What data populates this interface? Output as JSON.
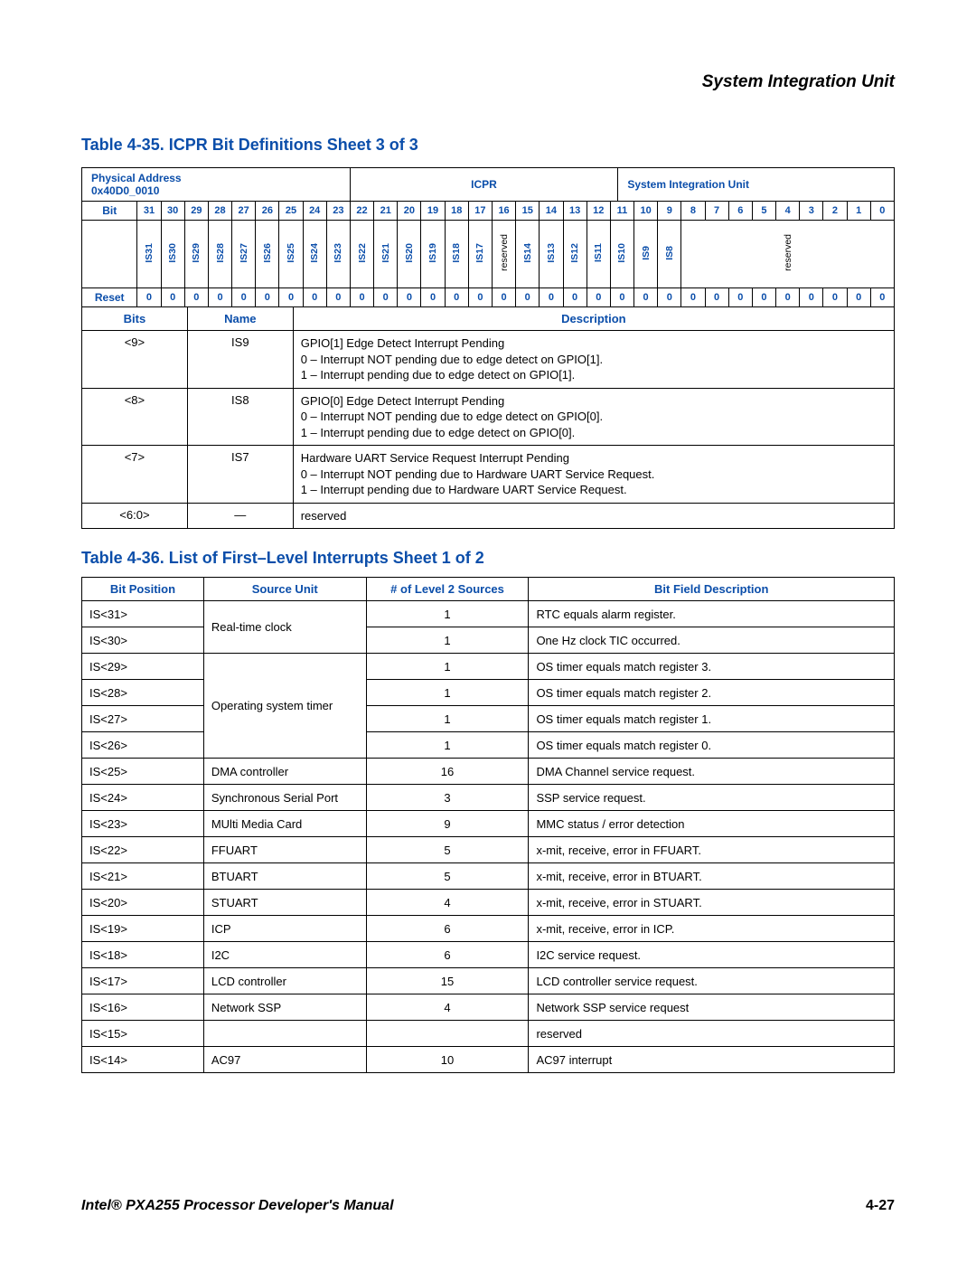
{
  "header": {
    "section": "System Integration Unit"
  },
  "table435": {
    "title": "Table 4-35. ICPR Bit Definitions Sheet 3 of 3",
    "meta": {
      "physical_label": "Physical Address",
      "physical_value": "0x40D0_0010",
      "register": "ICPR",
      "unit": "System Integration Unit"
    },
    "bit_row_label": "Bit",
    "reset_row_label": "Reset",
    "bit_numbers": [
      "31",
      "30",
      "29",
      "28",
      "27",
      "26",
      "25",
      "24",
      "23",
      "22",
      "21",
      "20",
      "19",
      "18",
      "17",
      "16",
      "15",
      "14",
      "13",
      "12",
      "11",
      "10",
      "9",
      "8",
      "7",
      "6",
      "5",
      "4",
      "3",
      "2",
      "1",
      "0"
    ],
    "bit_names": [
      "IS31",
      "IS30",
      "IS29",
      "IS28",
      "IS27",
      "IS26",
      "IS25",
      "IS24",
      "IS23",
      "IS22",
      "IS21",
      "IS20",
      "IS19",
      "IS18",
      "IS17",
      "reserved",
      "IS14",
      "IS13",
      "IS12",
      "IS11",
      "IS10",
      "IS9",
      "IS8",
      "",
      "",
      "",
      "",
      "",
      "",
      "",
      "",
      "reserved"
    ],
    "bit_reserved_flags": [
      false,
      false,
      false,
      false,
      false,
      false,
      false,
      false,
      false,
      false,
      false,
      false,
      false,
      false,
      false,
      true,
      false,
      false,
      false,
      false,
      false,
      false,
      false,
      false,
      false,
      false,
      false,
      false,
      false,
      false,
      false,
      true
    ],
    "reset_values": [
      "0",
      "0",
      "0",
      "0",
      "0",
      "0",
      "0",
      "0",
      "0",
      "0",
      "0",
      "0",
      "0",
      "0",
      "0",
      "0",
      "0",
      "0",
      "0",
      "0",
      "0",
      "0",
      "0",
      "0",
      "0",
      "0",
      "0",
      "0",
      "0",
      "0",
      "0",
      "0"
    ],
    "defs": {
      "headers": {
        "bits": "Bits",
        "name": "Name",
        "desc": "Description"
      },
      "rows": [
        {
          "bits": "<9>",
          "name": "IS9",
          "desc": [
            "GPIO[1] Edge Detect Interrupt Pending",
            "0 – Interrupt NOT pending due to edge detect on GPIO[1].",
            "1 – Interrupt pending due to edge detect on GPIO[1]."
          ]
        },
        {
          "bits": "<8>",
          "name": "IS8",
          "desc": [
            "GPIO[0] Edge Detect Interrupt Pending",
            "0 – Interrupt NOT pending due to edge detect on GPIO[0].",
            "1 – Interrupt pending due to edge detect on GPIO[0]."
          ]
        },
        {
          "bits": "<7>",
          "name": "IS7",
          "desc": [
            "Hardware UART Service Request Interrupt Pending",
            "0 – Interrupt NOT pending due to Hardware UART Service Request.",
            "1 – Interrupt pending due to Hardware UART Service Request."
          ]
        },
        {
          "bits": "<6:0>",
          "name": "—",
          "desc": [
            "reserved"
          ]
        }
      ]
    }
  },
  "table436": {
    "title": "Table 4-36. List of First–Level Interrupts Sheet 1 of 2",
    "headers": {
      "bitpos": "Bit Position",
      "source": "Source Unit",
      "level2": "# of Level 2 Sources",
      "desc": "Bit Field Description"
    },
    "rows": [
      {
        "bitpos": "IS<31>",
        "source": "Real-time clock",
        "rowspan": 2,
        "level2": "1",
        "desc": "RTC equals alarm register."
      },
      {
        "bitpos": "IS<30>",
        "level2": "1",
        "desc": "One Hz clock TIC occurred."
      },
      {
        "bitpos": "IS<29>",
        "source": "Operating system timer",
        "rowspan": 4,
        "level2": "1",
        "desc": "OS timer equals match register 3."
      },
      {
        "bitpos": "IS<28>",
        "level2": "1",
        "desc": "OS timer equals match register 2."
      },
      {
        "bitpos": "IS<27>",
        "level2": "1",
        "desc": "OS timer equals match register 1."
      },
      {
        "bitpos": "IS<26>",
        "level2": "1",
        "desc": "OS timer equals match register 0."
      },
      {
        "bitpos": "IS<25>",
        "source": "DMA controller",
        "rowspan": 1,
        "level2": "16",
        "desc": "DMA Channel service request."
      },
      {
        "bitpos": "IS<24>",
        "source": "Synchronous Serial Port",
        "rowspan": 1,
        "level2": "3",
        "desc": "SSP service request."
      },
      {
        "bitpos": "IS<23>",
        "source": "MUlti Media Card",
        "rowspan": 1,
        "level2": "9",
        "desc": "MMC status / error detection"
      },
      {
        "bitpos": "IS<22>",
        "source": "FFUART",
        "rowspan": 1,
        "level2": "5",
        "desc": "x-mit, receive, error in FFUART."
      },
      {
        "bitpos": "IS<21>",
        "source": "BTUART",
        "rowspan": 1,
        "level2": "5",
        "desc": "x-mit, receive, error in BTUART."
      },
      {
        "bitpos": "IS<20>",
        "source": "STUART",
        "rowspan": 1,
        "level2": "4",
        "desc": "x-mit, receive, error in STUART."
      },
      {
        "bitpos": "IS<19>",
        "source": "ICP",
        "rowspan": 1,
        "level2": "6",
        "desc": "x-mit, receive, error in ICP."
      },
      {
        "bitpos": "IS<18>",
        "source": "I2C",
        "rowspan": 1,
        "level2": "6",
        "desc": "I2C service request."
      },
      {
        "bitpos": "IS<17>",
        "source": "LCD controller",
        "rowspan": 1,
        "level2": "15",
        "desc": "LCD controller service request."
      },
      {
        "bitpos": "IS<16>",
        "source": "Network SSP",
        "rowspan": 1,
        "level2": "4",
        "desc": "Network SSP service request"
      },
      {
        "bitpos": "IS<15>",
        "source": "",
        "rowspan": 1,
        "level2": "",
        "desc": "reserved"
      },
      {
        "bitpos": "IS<14>",
        "source": "AC97",
        "rowspan": 1,
        "level2": "10",
        "desc": "AC97 interrupt"
      }
    ]
  },
  "footer": {
    "manual": "Intel® PXA255 Processor Developer's Manual",
    "page": "4-27"
  }
}
